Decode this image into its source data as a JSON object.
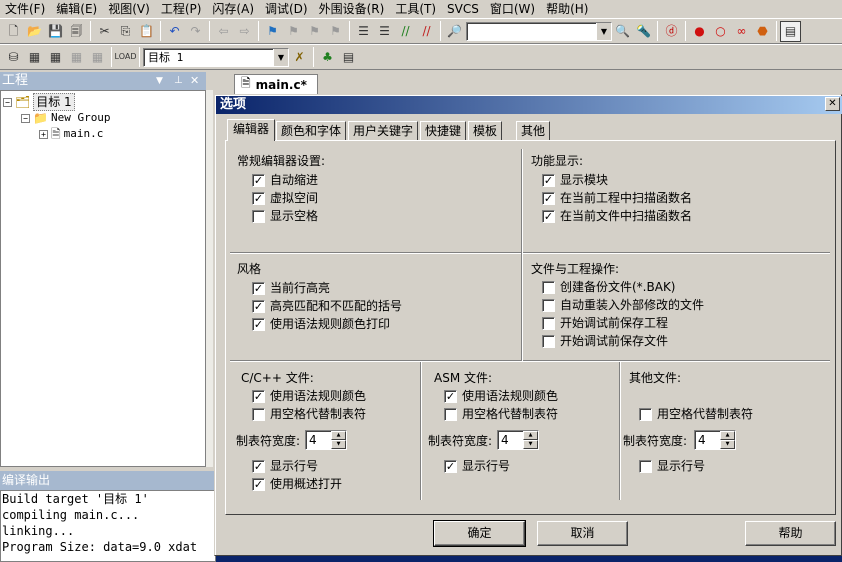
{
  "menubar": [
    {
      "label": "文件(F)",
      "name": "menu-file"
    },
    {
      "label": "编辑(E)",
      "name": "menu-edit"
    },
    {
      "label": "视图(V)",
      "name": "menu-view"
    },
    {
      "label": "工程(P)",
      "name": "menu-project"
    },
    {
      "label": "闪存(A)",
      "name": "menu-flash"
    },
    {
      "label": "调试(D)",
      "name": "menu-debug"
    },
    {
      "label": "外围设备(R)",
      "name": "menu-peripherals"
    },
    {
      "label": "工具(T)",
      "name": "menu-tools"
    },
    {
      "label": "SVCS",
      "name": "menu-svcs"
    },
    {
      "label": "窗口(W)",
      "name": "menu-window"
    },
    {
      "label": "帮助(H)",
      "name": "menu-help"
    }
  ],
  "toolbar": {
    "target_select": "目标 1"
  },
  "project_panel": {
    "title": "工程",
    "target": "目标 1",
    "group": "New Group",
    "file": "main.c",
    "expanded_sign": "−",
    "collapsed_sign": "+"
  },
  "output_panel": {
    "title": "编译输出",
    "lines": [
      "Build target '目标 1'",
      "compiling main.c...",
      "linking...",
      "Program Size: data=9.0 xdat"
    ]
  },
  "editor": {
    "tab_label": "main.c*"
  },
  "dialog": {
    "title": "选项",
    "close_glyph": "✕",
    "check_glyph": "✓",
    "tabs": [
      "编辑器",
      "颜色和字体",
      "用户关键字",
      "快捷键",
      "模板",
      "其他"
    ],
    "active_tab": 0,
    "general": {
      "title": "常规编辑器设置:",
      "options": [
        {
          "label": "自动缩进",
          "checked": true
        },
        {
          "label": "虚拟空间",
          "checked": true
        },
        {
          "label": "显示空格",
          "checked": false
        }
      ]
    },
    "function_display": {
      "title": "功能显示:",
      "options": [
        {
          "label": "显示模块",
          "checked": true
        },
        {
          "label": "在当前工程中扫描函数名",
          "checked": true
        },
        {
          "label": "在当前文件中扫描函数名",
          "checked": true
        }
      ]
    },
    "style": {
      "title": "风格",
      "options": [
        {
          "label": "当前行高亮",
          "checked": true
        },
        {
          "label": "高亮匹配和不匹配的括号",
          "checked": true
        },
        {
          "label": "使用语法规则颜色打印",
          "checked": true
        }
      ]
    },
    "file_project": {
      "title": "文件与工程操作:",
      "options": [
        {
          "label": "创建备份文件(*.BAK)",
          "checked": false
        },
        {
          "label": "自动重装入外部修改的文件",
          "checked": false
        },
        {
          "label": "开始调试前保存工程",
          "checked": false
        },
        {
          "label": "开始调试前保存文件",
          "checked": false
        }
      ]
    },
    "tab_size_label": "制表符宽度:",
    "c_files": {
      "title": "C/C++ 文件:",
      "syntax_color": {
        "label": "使用语法规则颜色",
        "checked": true
      },
      "spaces_for_tab": {
        "label": "用空格代替制表符",
        "checked": false
      },
      "tab_size": "4",
      "line_numbers": {
        "label": "显示行号",
        "checked": true
      },
      "outlining": {
        "label": "使用概述打开",
        "checked": true
      }
    },
    "asm_files": {
      "title": "ASM 文件:",
      "syntax_color": {
        "label": "使用语法规则颜色",
        "checked": true
      },
      "spaces_for_tab": {
        "label": "用空格代替制表符",
        "checked": false
      },
      "tab_size": "4",
      "line_numbers": {
        "label": "显示行号",
        "checked": true
      }
    },
    "other_files": {
      "title": "其他文件:",
      "spaces_for_tab": {
        "label": "用空格代替制表符",
        "checked": false
      },
      "tab_size": "4",
      "line_numbers": {
        "label": "显示行号",
        "checked": false
      }
    },
    "buttons": {
      "ok": "确定",
      "cancel": "取消",
      "help": "帮助"
    }
  }
}
